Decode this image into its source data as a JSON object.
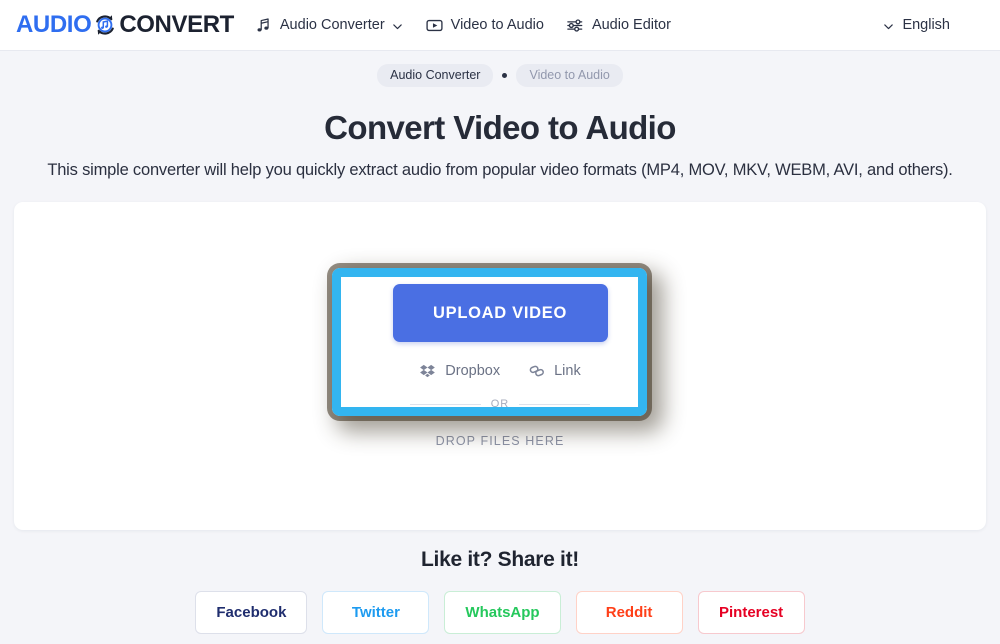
{
  "header": {
    "logo": {
      "part1": "AUDIO",
      "part2": "CONVERT",
      "mark_icon": "audio-refresh-icon"
    },
    "nav": [
      {
        "label": "Audio Converter",
        "icon": "music-note-icon",
        "has_dropdown": true
      },
      {
        "label": "Video to Audio",
        "icon": "video-play-icon",
        "has_dropdown": false
      },
      {
        "label": "Audio Editor",
        "icon": "sliders-icon",
        "has_dropdown": false
      }
    ],
    "language": {
      "label": "English",
      "icon": "chevron-down-icon"
    }
  },
  "breadcrumb": {
    "items": [
      {
        "label": "Audio Converter",
        "muted": false
      },
      {
        "label": "Video to Audio",
        "muted": true
      }
    ],
    "separator_icon": "dot-separator-icon"
  },
  "main": {
    "title": "Convert Video to Audio",
    "subtitle": "This simple converter will help you quickly extract audio from popular video formats (MP4, MOV, MKV, WEBM, AVI, and others).",
    "upload_button": "UPLOAD VIDEO",
    "alt_sources": [
      {
        "label": "Dropbox",
        "icon": "dropbox-icon"
      },
      {
        "label": "Link",
        "icon": "link-icon"
      }
    ],
    "or_label": "OR",
    "drop_text": "DROP FILES HERE"
  },
  "share": {
    "title": "Like it? Share it!",
    "buttons": [
      {
        "label": "Facebook",
        "color": "#1f2d6e",
        "border": "#dde0ea"
      },
      {
        "label": "Twitter",
        "color": "#1d9bf0",
        "border": "#cfe8fb"
      },
      {
        "label": "WhatsApp",
        "color": "#25c85c",
        "border": "#c9eed6"
      },
      {
        "label": "Reddit",
        "color": "#ff3f18",
        "border": "#ffd2c7"
      },
      {
        "label": "Pinterest",
        "color": "#e60023",
        "border": "#f7c9ce"
      }
    ]
  },
  "colors": {
    "page_background": "#f4f5f9",
    "accent_blue": "#4a6fe3",
    "logo_blue": "#2f6ef0",
    "highlight_outline": "#33b5f0",
    "card_background": "#ffffff"
  }
}
